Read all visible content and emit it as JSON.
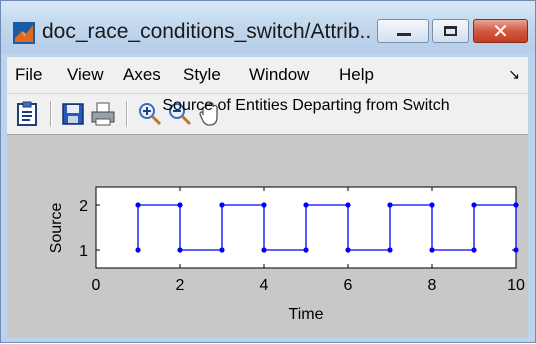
{
  "window": {
    "title": "doc_race_conditions_switch/Attrib...",
    "minimize_label": "",
    "maximize_label": "",
    "close_glyph": "✕"
  },
  "menu": {
    "items": [
      "File",
      "View",
      "Axes",
      "Style",
      "Window",
      "Help"
    ],
    "corner_glyph": "↘"
  },
  "toolbar": {
    "icons": [
      "clipboard-icon",
      "save-icon",
      "print-icon",
      "zoom-in-icon",
      "zoom-out-icon",
      "pan-hand-icon"
    ]
  },
  "colors": {
    "line": "#0000ff",
    "figure_bg": "#c8c8c8",
    "axes_bg": "#ffffff"
  },
  "chart_data": {
    "type": "line",
    "title": "Source of Entities Departing from Switch",
    "xlabel": "Time",
    "ylabel": "Source",
    "xlim": [
      0,
      10
    ],
    "ylim": [
      0.6,
      2.4
    ],
    "xticks": [
      0,
      2,
      4,
      6,
      8,
      10
    ],
    "yticks": [
      1,
      2
    ],
    "xtick_labels": [
      "0",
      "2",
      "4",
      "6",
      "8",
      "10"
    ],
    "ytick_labels": [
      "1",
      "2"
    ],
    "step": "post",
    "marker": "dot",
    "grid": false,
    "x": [
      1,
      1,
      2,
      2,
      3,
      3,
      4,
      4,
      5,
      5,
      6,
      6,
      7,
      7,
      8,
      8,
      9,
      9,
      10,
      10
    ],
    "y": [
      1,
      2,
      2,
      1,
      1,
      2,
      2,
      1,
      1,
      2,
      2,
      1,
      1,
      2,
      2,
      1,
      1,
      2,
      2,
      1
    ]
  }
}
